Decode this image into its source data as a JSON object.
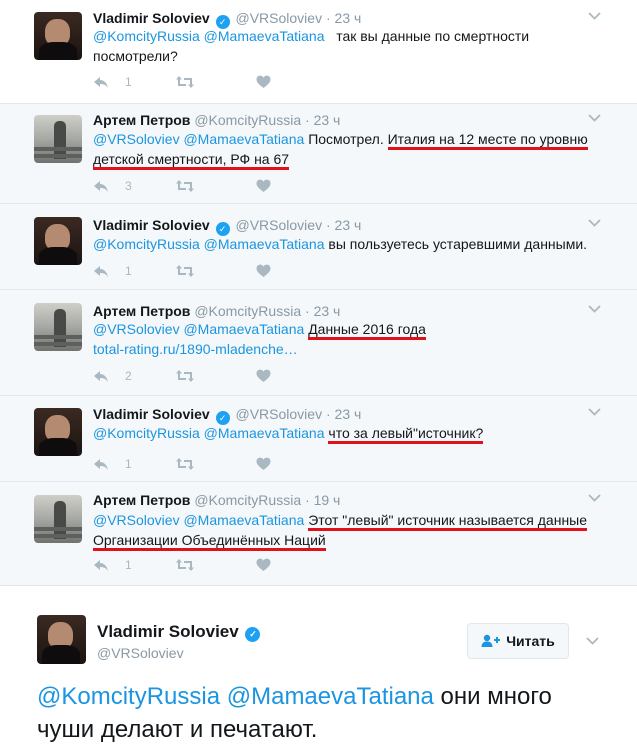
{
  "tweets": [
    {
      "name": "Vladimir Soloviev",
      "verified": true,
      "handle": "@VRSoloviev",
      "time": "23 ч",
      "mentions": "@KomcityRussia @MamaevaTatiana",
      "text_plain": "так вы данные по смертности посмотрели?",
      "reply_count": "1"
    },
    {
      "name": "Артем Петров",
      "verified": false,
      "handle": "@KomcityRussia",
      "time": "23 ч",
      "mentions": "@VRSoloviev @MamaevaTatiana",
      "text_plain": "Посмотрел.",
      "text_highlight": "Италия на 12 месте по уровню детской смертности, РФ на 67",
      "reply_count": "3"
    },
    {
      "name": "Vladimir Soloviev",
      "verified": true,
      "handle": "@VRSoloviev",
      "time": "23 ч",
      "mentions": "@KomcityRussia @MamaevaTatiana",
      "text_plain": "вы пользуетесь устаревшими данными.",
      "reply_count": "1"
    },
    {
      "name": "Артем Петров",
      "verified": false,
      "handle": "@KomcityRussia",
      "time": "23 ч",
      "mentions": "@VRSoloviev @MamaevaTatiana",
      "text_highlight": "Данные 2016 года",
      "link": "total-rating.ru/1890-mladenche…",
      "reply_count": "2"
    },
    {
      "name": "Vladimir Soloviev",
      "verified": true,
      "handle": "@VRSoloviev",
      "time": "23 ч",
      "mentions": "@KomcityRussia @MamaevaTatiana",
      "text_highlight": "что за левый\"источник?",
      "reply_count": "1"
    },
    {
      "name": "Артем Петров",
      "verified": false,
      "handle": "@KomcityRussia",
      "time": "19 ч",
      "mentions": "@VRSoloviev @MamaevaTatiana",
      "text_highlight_1": "Этот \"левый\" источник называется данные",
      "text_highlight_2": "Организации Объединённых Наций",
      "reply_count": "1"
    }
  ],
  "main_tweet": {
    "name": "Vladimir Soloviev",
    "verified": true,
    "handle": "@VRSoloviev",
    "follow_label": "Читать",
    "mentions": "@KomcityRussia @MamaevaTatiana",
    "text": "они много чуши делают и печатают."
  },
  "colors": {
    "link": "#1b95e0",
    "highlight_underline": "#e0111b",
    "icon": "#aab8c2",
    "verified": "#1da1f2"
  }
}
